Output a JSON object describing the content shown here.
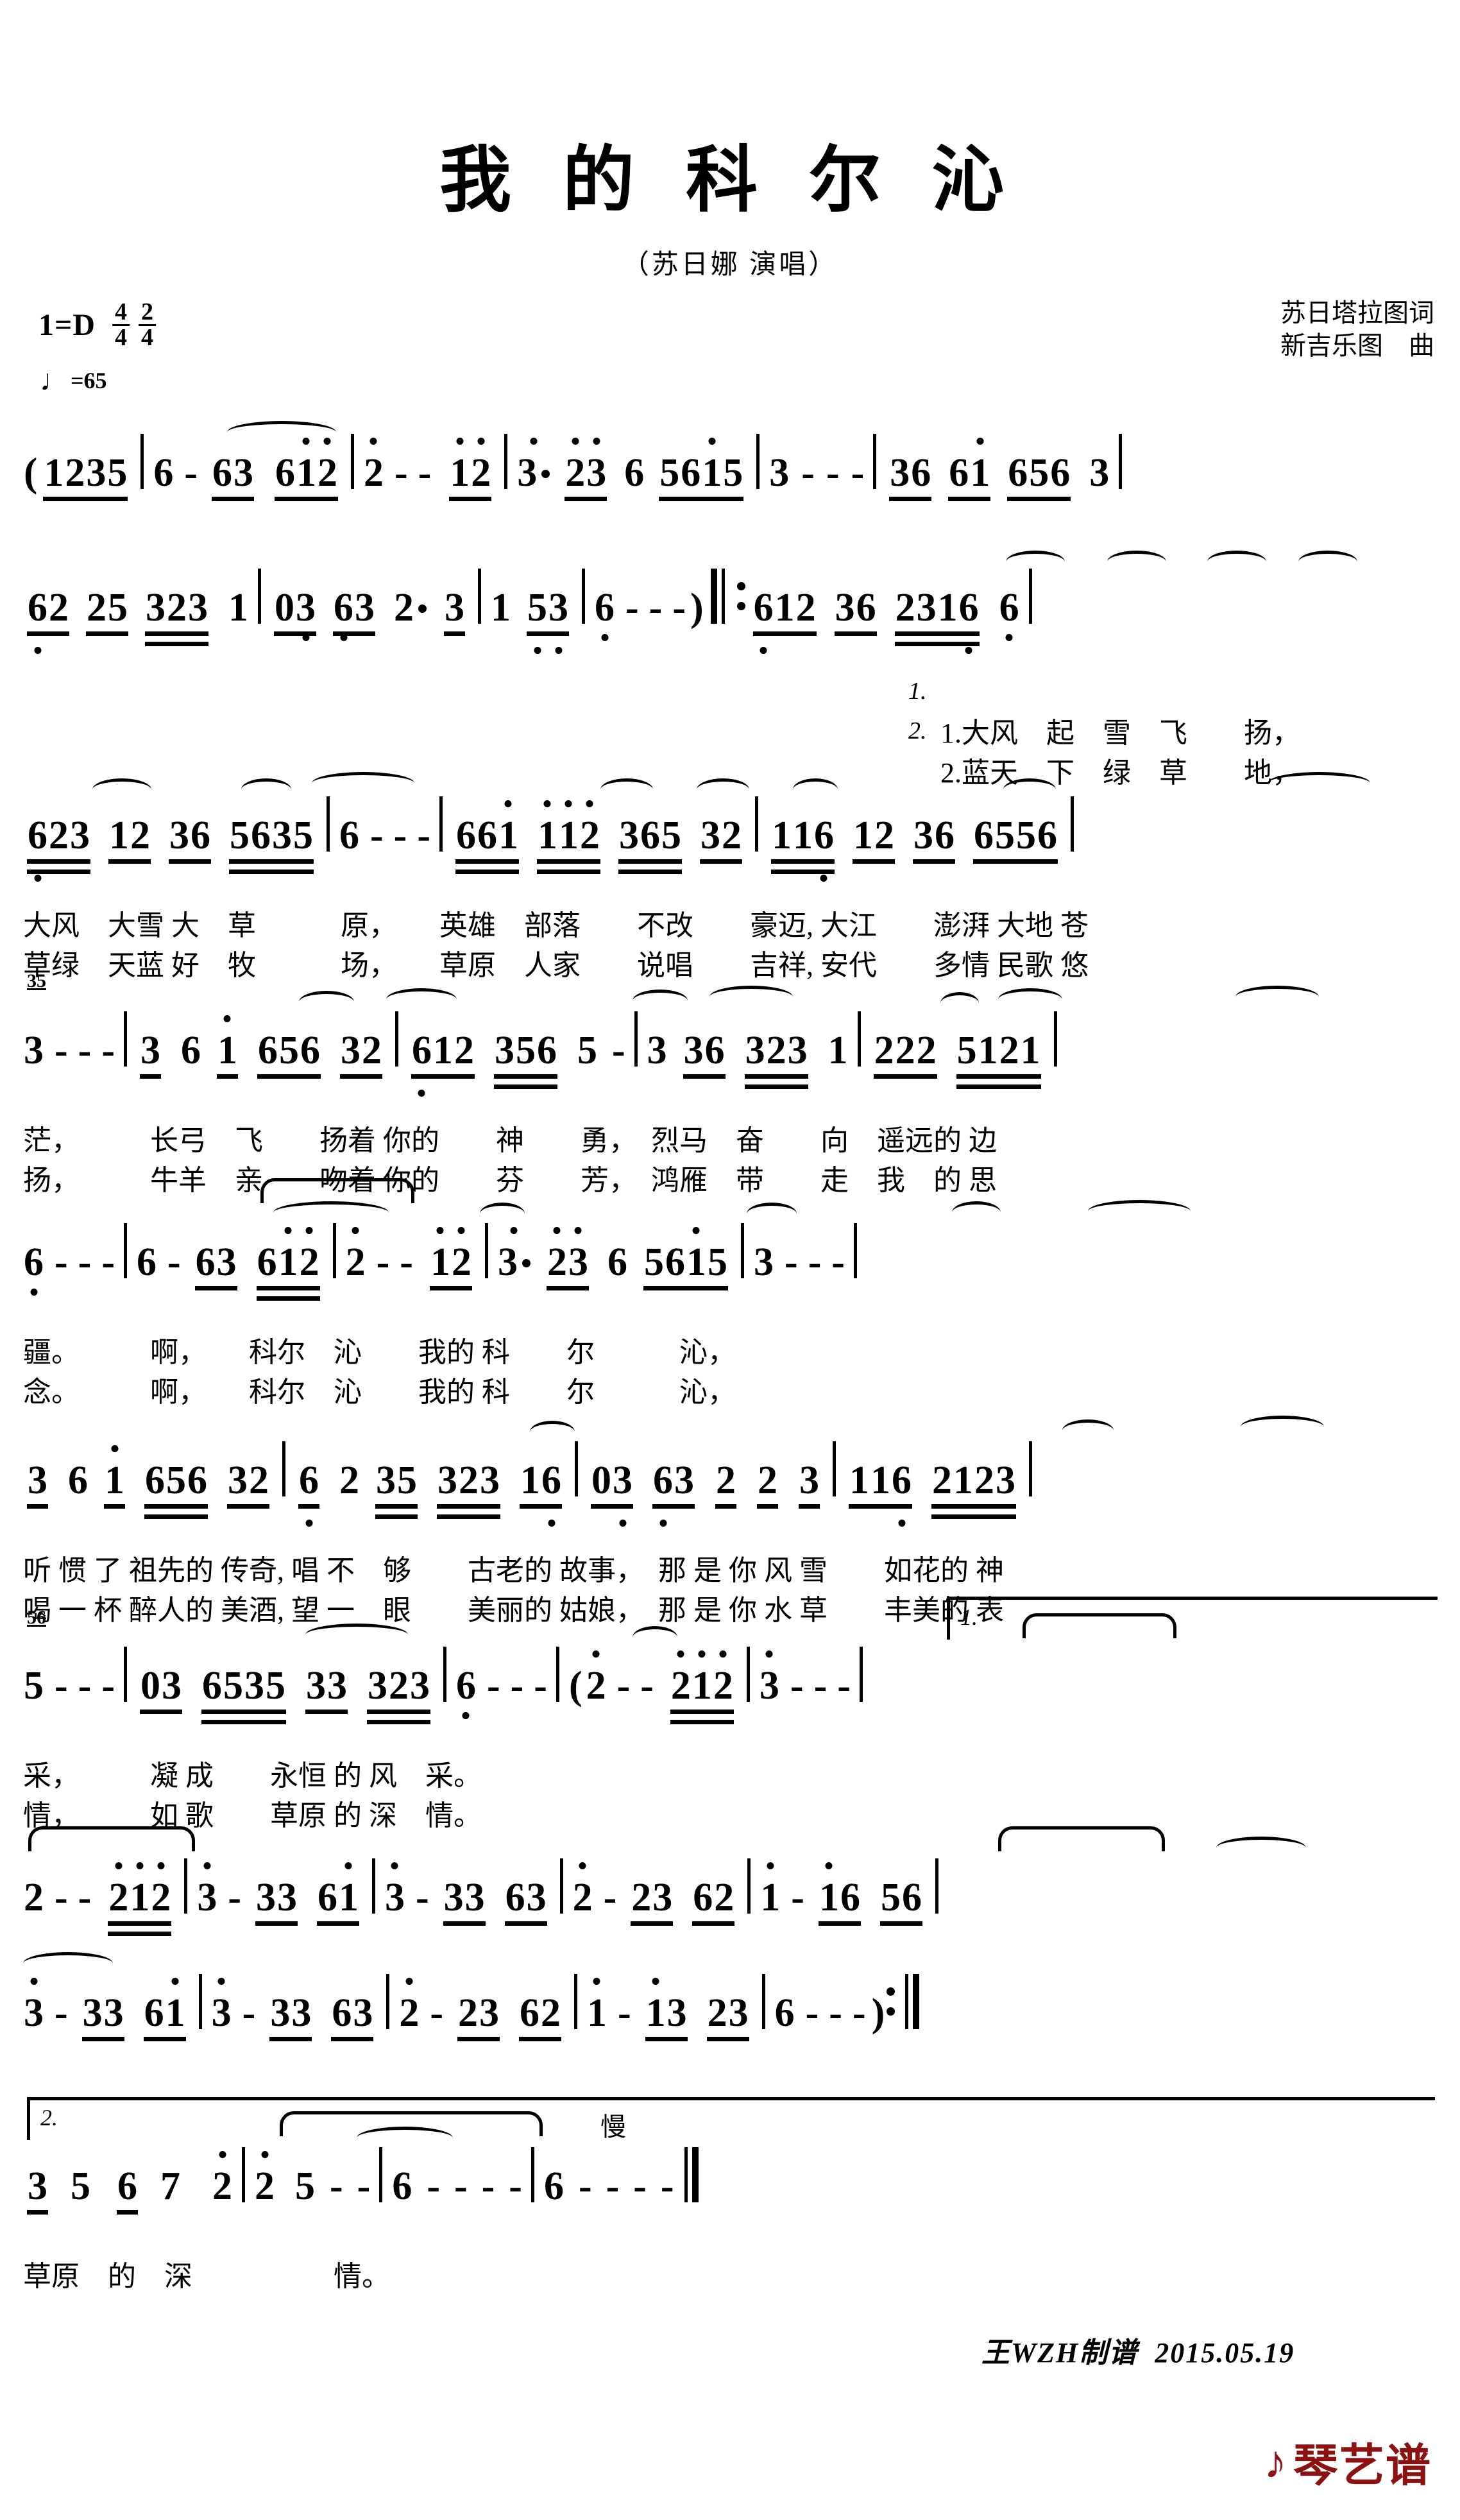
{
  "header": {
    "title": "我 的 科 尔 沁",
    "subtitle": "（苏日娜 演唱）",
    "key_label": "1=D",
    "meter_primary": {
      "num": "4",
      "den": "4"
    },
    "meter_secondary": {
      "num": "2",
      "den": "4"
    },
    "tempo_note": "♩",
    "tempo_text": "=65",
    "lyricist": "苏日塔拉图词",
    "composer": "新吉乐图　曲"
  },
  "score": {
    "measure_numbers": [
      "35",
      "56"
    ],
    "volta1_label": "1.",
    "volta2_label": "2.",
    "slow_marking": "慢",
    "lines": [
      {
        "id": "line-1",
        "notes": "( 1 2 3 5 | 6 - 6 3  6 1 2 | 2 - - 1 2 | 3. 2 3 6  5 6 1 5 | 3 - - - | 3 6  6 1  6 5 6  3 |",
        "lyrics1": "",
        "lyrics2": ""
      },
      {
        "id": "line-2",
        "notes": "6 2  2 5  3 2 3  1 | 0 3  6 3  2.  3 | 1  5 3 | 6 - - - ) ‖: 6 1 2  3 6  2 3 1 6  6 |",
        "lyrics1": "1.大风　起　雪　飞　　扬，",
        "lyrics2": "2.蓝天　下　绿　草　　地，"
      },
      {
        "id": "line-3",
        "notes": "6 2 3  1 2  3 6  5 6 3 5 | 6 - - - | 6 6 1  1 1 2  3 6 5  3 2 | 1 1 6  1 2  3 6  6 5 5 6 |",
        "lyrics1": "大风　大雪 大　草　　　原，　　英雄　部落　　不改　　豪迈, 大江　　澎湃 大地 苍",
        "lyrics2": "草绿　天蓝 好　牧　　　场，　　草原　人家　　说唱　　吉祥, 安代　　多情 民歌 悠"
      },
      {
        "id": "line-4",
        "notes": "3 - - - | 3 6 1  6 5 6  3 2 | 6 1 2  3 5 6 5 - | 3 3 6  3 2 3  1 | 2 2 2  5 1 2 1 |",
        "lyrics1": "茫，　　　长弓　飞　　扬着 你的　　神　　勇，　烈马　奋　　向　遥远的 边",
        "lyrics2": "扬，　　　牛羊　亲　　吻着 你的　　芬　　芳，　鸿雁　带　　走　我　的 思"
      },
      {
        "id": "line-5",
        "notes": "6 - - - | 6 - 6 3  6 1 2 | 2 - - 1 2 | 3. 2 3 6  5 6 1 5 | 3 - - - |",
        "lyrics1": "疆。　　　啊，　　科尔　沁　　我的 科　　尔　　　沁，",
        "lyrics2": "念。　　　啊，　　科尔　沁　　我的 科　　尔　　　沁，"
      },
      {
        "id": "line-6",
        "notes": "3 6 1  6 5 6  3 2 | 6 2  3 5  3 2 3  1 6 | 0 3  6 3  2  2  3 | 1 1 6  2 1 2 3 |",
        "lyrics1": "听 惯 了 祖先的 传奇, 唱 不　够　　古老的 故事，　那 是 你 风 雪　　如花的 神",
        "lyrics2": "喝 一 杯 醉人的 美酒, 望 一　眼　　美丽的 姑娘，　那 是 你 水 草　　丰美的 表"
      },
      {
        "id": "line-7",
        "notes": "5 - - - | 0 3  6 5 3 5  3 3  3 2 3 | 6 - - - | ( 2 - - 2 1 2 | 3 - - -",
        "lyrics1": "采，　　　凝 成　　永恒 的 风　采。",
        "lyrics2": "情，　　　如 歌　　草原 的 深　情。"
      },
      {
        "id": "line-8",
        "notes": "2 - - 2 1 2 | 3 - 3 3 6 1 | 3 - 3 3 6 3 | 2 - 2 3 6 2 | 1 - 1 6 5 6 |",
        "lyrics1": "",
        "lyrics2": ""
      },
      {
        "id": "line-9",
        "notes": "3 - 3 3 6 1 | 3 - 3 3 6 3 | 2 - 2 3 6 2 | 1 - 1 3 2 3 | 6 - - - ) :‖",
        "lyrics1": "",
        "lyrics2": ""
      },
      {
        "id": "line-10",
        "notes": "3 5  6 7  2 | 2 5 - - | 6 - - - | 6 - - - ‖",
        "lyrics1": "草原　的　深　　　　　情。",
        "lyrics2": ""
      }
    ]
  },
  "footer": {
    "signature": "王WZH制谱  2015.05.19",
    "logo_text": "琴艺谱",
    "logo_color": "#8c1111"
  }
}
